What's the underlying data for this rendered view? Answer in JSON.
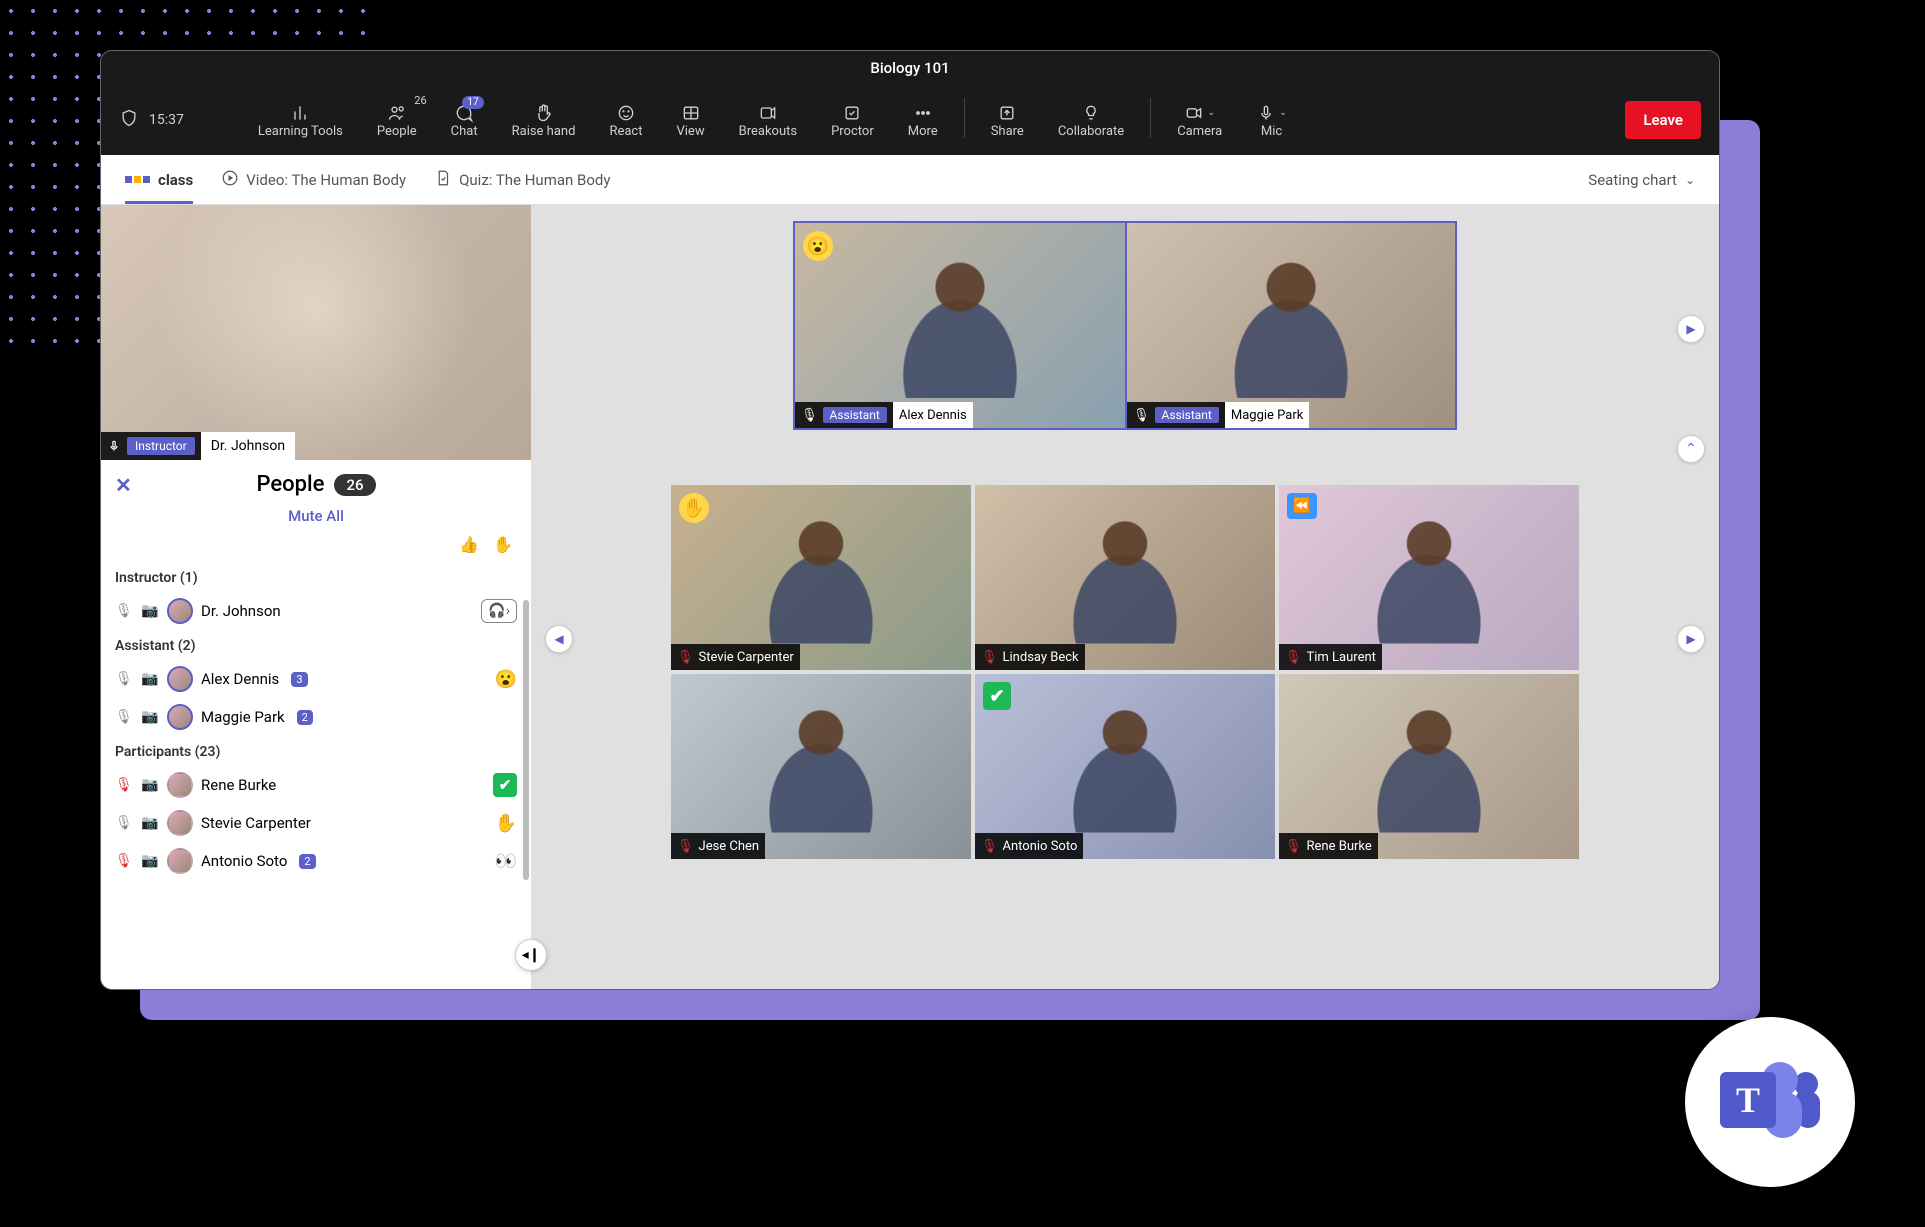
{
  "window": {
    "title": "Biology 101",
    "time": "15:37"
  },
  "toolbar": {
    "learning_tools": "Learning Tools",
    "people": "People",
    "people_badge": "26",
    "chat": "Chat",
    "chat_badge": "17",
    "raise_hand": "Raise hand",
    "react": "React",
    "view": "View",
    "breakouts": "Breakouts",
    "proctor": "Proctor",
    "more": "More",
    "share": "Share",
    "collaborate": "Collaborate",
    "camera": "Camera",
    "mic": "Mic",
    "leave": "Leave"
  },
  "subbar": {
    "brand": "class",
    "video_tab": "Video: The Human Body",
    "quiz_tab": "Quiz: The Human Body",
    "seating_chart": "Seating chart"
  },
  "self": {
    "role": "Instructor",
    "name": "Dr. Johnson"
  },
  "people_panel": {
    "title": "People",
    "count": "26",
    "mute_all": "Mute All",
    "groups": {
      "instructor": {
        "label": "Instructor (1)",
        "items": [
          {
            "name": "Dr. Johnson",
            "muted": false,
            "ring": true,
            "headset": true
          }
        ]
      },
      "assistant": {
        "label": "Assistant (2)",
        "items": [
          {
            "name": "Alex Dennis",
            "muted": false,
            "ring": true,
            "chat": "3",
            "emoji": "😮"
          },
          {
            "name": "Maggie Park",
            "muted": false,
            "ring": true,
            "chat": "2"
          }
        ]
      },
      "participants": {
        "label": "Participants (23)",
        "items": [
          {
            "name": "Rene Burke",
            "muted": true,
            "check": true
          },
          {
            "name": "Stevie Carpenter",
            "muted": false,
            "emoji": "✋"
          },
          {
            "name": "Antonio Soto",
            "muted": true,
            "chat": "2",
            "eyes": "👀"
          }
        ]
      }
    }
  },
  "assistants": [
    {
      "name": "Alex Dennis",
      "role": "Assistant",
      "reaction": "😮",
      "muted": false
    },
    {
      "name": "Maggie Park",
      "role": "Assistant",
      "muted": false
    }
  ],
  "grid": [
    {
      "name": "Stevie Carpenter",
      "muted": true,
      "reaction": "✋",
      "bg": "linear-gradient(135deg,#c8b090,#8a9a88)"
    },
    {
      "name": "Lindsay Beck",
      "muted": true,
      "bg": "linear-gradient(135deg,#d0c0a8,#9a8a78)"
    },
    {
      "name": "Tim Laurent",
      "muted": true,
      "reaction": "⏪",
      "reaction_type": "blue",
      "bg": "linear-gradient(135deg,#e0c8d8,#b8a8c0)"
    },
    {
      "name": "Jese Chen",
      "muted": true,
      "bg": "linear-gradient(135deg,#c0c8d0,#889098)"
    },
    {
      "name": "Antonio Soto",
      "muted": true,
      "reaction": "✔",
      "reaction_type": "green",
      "bg": "linear-gradient(135deg,#b8c0d8,#8890b0)"
    },
    {
      "name": "Rene Burke",
      "muted": true,
      "bg": "linear-gradient(135deg,#d0c8b8,#a89888)"
    }
  ],
  "teams_letter": "T"
}
